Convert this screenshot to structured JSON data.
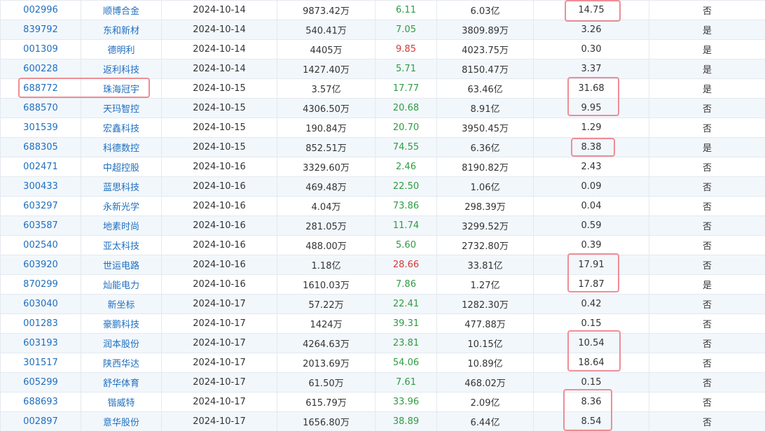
{
  "colors": {
    "link": "#1f6fbf",
    "pe_green": "#2e9c42",
    "pe_red": "#d33a3a",
    "highlight_box": "#ef8d96",
    "row_alt": "#f2f7fc"
  },
  "table": {
    "rows": [
      {
        "code": "002996",
        "name": "顺博合金",
        "date": "2024-10-14",
        "amount": "9873.42万",
        "pe": "6.11",
        "pe_color": "up",
        "mcap": "6.03亿",
        "ratio": "14.75",
        "flag": "否"
      },
      {
        "code": "839792",
        "name": "东和新材",
        "date": "2024-10-14",
        "amount": "540.41万",
        "pe": "7.05",
        "pe_color": "up",
        "mcap": "3809.89万",
        "ratio": "3.26",
        "flag": "是"
      },
      {
        "code": "001309",
        "name": "德明利",
        "date": "2024-10-14",
        "amount": "4405万",
        "pe": "9.85",
        "pe_color": "down",
        "mcap": "4023.75万",
        "ratio": "0.30",
        "flag": "是"
      },
      {
        "code": "600228",
        "name": "返利科技",
        "date": "2024-10-14",
        "amount": "1427.40万",
        "pe": "5.71",
        "pe_color": "up",
        "mcap": "8150.47万",
        "ratio": "3.37",
        "flag": "是"
      },
      {
        "code": "688772",
        "name": "珠海冠宇",
        "date": "2024-10-15",
        "amount": "3.57亿",
        "pe": "17.77",
        "pe_color": "up",
        "mcap": "63.46亿",
        "ratio": "31.68",
        "flag": "是"
      },
      {
        "code": "688570",
        "name": "天玛智控",
        "date": "2024-10-15",
        "amount": "4306.50万",
        "pe": "20.68",
        "pe_color": "up",
        "mcap": "8.91亿",
        "ratio": "9.95",
        "flag": "否"
      },
      {
        "code": "301539",
        "name": "宏鑫科技",
        "date": "2024-10-15",
        "amount": "190.84万",
        "pe": "20.70",
        "pe_color": "up",
        "mcap": "3950.45万",
        "ratio": "1.29",
        "flag": "否"
      },
      {
        "code": "688305",
        "name": "科德数控",
        "date": "2024-10-15",
        "amount": "852.51万",
        "pe": "74.55",
        "pe_color": "up",
        "mcap": "6.36亿",
        "ratio": "8.38",
        "flag": "是"
      },
      {
        "code": "002471",
        "name": "中超控股",
        "date": "2024-10-16",
        "amount": "3329.60万",
        "pe": "2.46",
        "pe_color": "up",
        "mcap": "8190.82万",
        "ratio": "2.43",
        "flag": "否"
      },
      {
        "code": "300433",
        "name": "蓝思科技",
        "date": "2024-10-16",
        "amount": "469.48万",
        "pe": "22.50",
        "pe_color": "up",
        "mcap": "1.06亿",
        "ratio": "0.09",
        "flag": "否"
      },
      {
        "code": "603297",
        "name": "永新光学",
        "date": "2024-10-16",
        "amount": "4.04万",
        "pe": "73.86",
        "pe_color": "up",
        "mcap": "298.39万",
        "ratio": "0.04",
        "flag": "否"
      },
      {
        "code": "603587",
        "name": "地素时尚",
        "date": "2024-10-16",
        "amount": "281.05万",
        "pe": "11.74",
        "pe_color": "up",
        "mcap": "3299.52万",
        "ratio": "0.59",
        "flag": "否"
      },
      {
        "code": "002540",
        "name": "亚太科技",
        "date": "2024-10-16",
        "amount": "488.00万",
        "pe": "5.60",
        "pe_color": "up",
        "mcap": "2732.80万",
        "ratio": "0.39",
        "flag": "否"
      },
      {
        "code": "603920",
        "name": "世运电路",
        "date": "2024-10-16",
        "amount": "1.18亿",
        "pe": "28.66",
        "pe_color": "down",
        "mcap": "33.81亿",
        "ratio": "17.91",
        "flag": "否"
      },
      {
        "code": "870299",
        "name": "灿能电力",
        "date": "2024-10-16",
        "amount": "1610.03万",
        "pe": "7.86",
        "pe_color": "up",
        "mcap": "1.27亿",
        "ratio": "17.87",
        "flag": "是"
      },
      {
        "code": "603040",
        "name": "新坐标",
        "date": "2024-10-17",
        "amount": "57.22万",
        "pe": "22.41",
        "pe_color": "up",
        "mcap": "1282.30万",
        "ratio": "0.42",
        "flag": "否"
      },
      {
        "code": "001283",
        "name": "豪鹏科技",
        "date": "2024-10-17",
        "amount": "1424万",
        "pe": "39.31",
        "pe_color": "up",
        "mcap": "477.88万",
        "ratio": "0.15",
        "flag": "否"
      },
      {
        "code": "603193",
        "name": "润本股份",
        "date": "2024-10-17",
        "amount": "4264.63万",
        "pe": "23.81",
        "pe_color": "up",
        "mcap": "10.15亿",
        "ratio": "10.54",
        "flag": "否"
      },
      {
        "code": "301517",
        "name": "陕西华达",
        "date": "2024-10-17",
        "amount": "2013.69万",
        "pe": "54.06",
        "pe_color": "up",
        "mcap": "10.89亿",
        "ratio": "18.64",
        "flag": "否"
      },
      {
        "code": "605299",
        "name": "舒华体育",
        "date": "2024-10-17",
        "amount": "61.50万",
        "pe": "7.61",
        "pe_color": "up",
        "mcap": "468.02万",
        "ratio": "0.15",
        "flag": "否"
      },
      {
        "code": "688693",
        "name": "锴威特",
        "date": "2024-10-17",
        "amount": "615.79万",
        "pe": "33.96",
        "pe_color": "up",
        "mcap": "2.09亿",
        "ratio": "8.36",
        "flag": "否"
      },
      {
        "code": "002897",
        "name": "意华股份",
        "date": "2024-10-17",
        "amount": "1656.80万",
        "pe": "38.89",
        "pe_color": "up",
        "mcap": "6.44亿",
        "ratio": "8.54",
        "flag": "否"
      }
    ]
  }
}
